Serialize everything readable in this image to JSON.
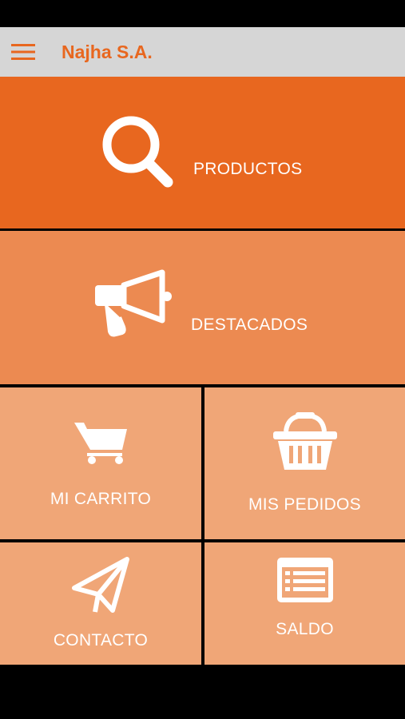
{
  "app": {
    "title": "Najha S.A."
  },
  "icons": {
    "menu": "hamburger-menu-icon",
    "productos": "search-icon",
    "destacados": "megaphone-icon",
    "carrito": "shopping-cart-icon",
    "pedidos": "basket-icon",
    "contacto": "paper-plane-icon",
    "saldo": "list-card-icon"
  },
  "tiles": {
    "productos": "PRODUCTOS",
    "destacados": "DESTACADOS",
    "carrito": "MI CARRITO",
    "pedidos": "MIS PEDIDOS",
    "contacto": "CONTACTO",
    "saldo": "SALDO"
  },
  "colors": {
    "accent": "#e8671f",
    "tile_primary": "#e8671f",
    "tile_secondary": "#ec8a51",
    "tile_tertiary": "#f0a677",
    "app_bar": "#d6d6d6"
  }
}
